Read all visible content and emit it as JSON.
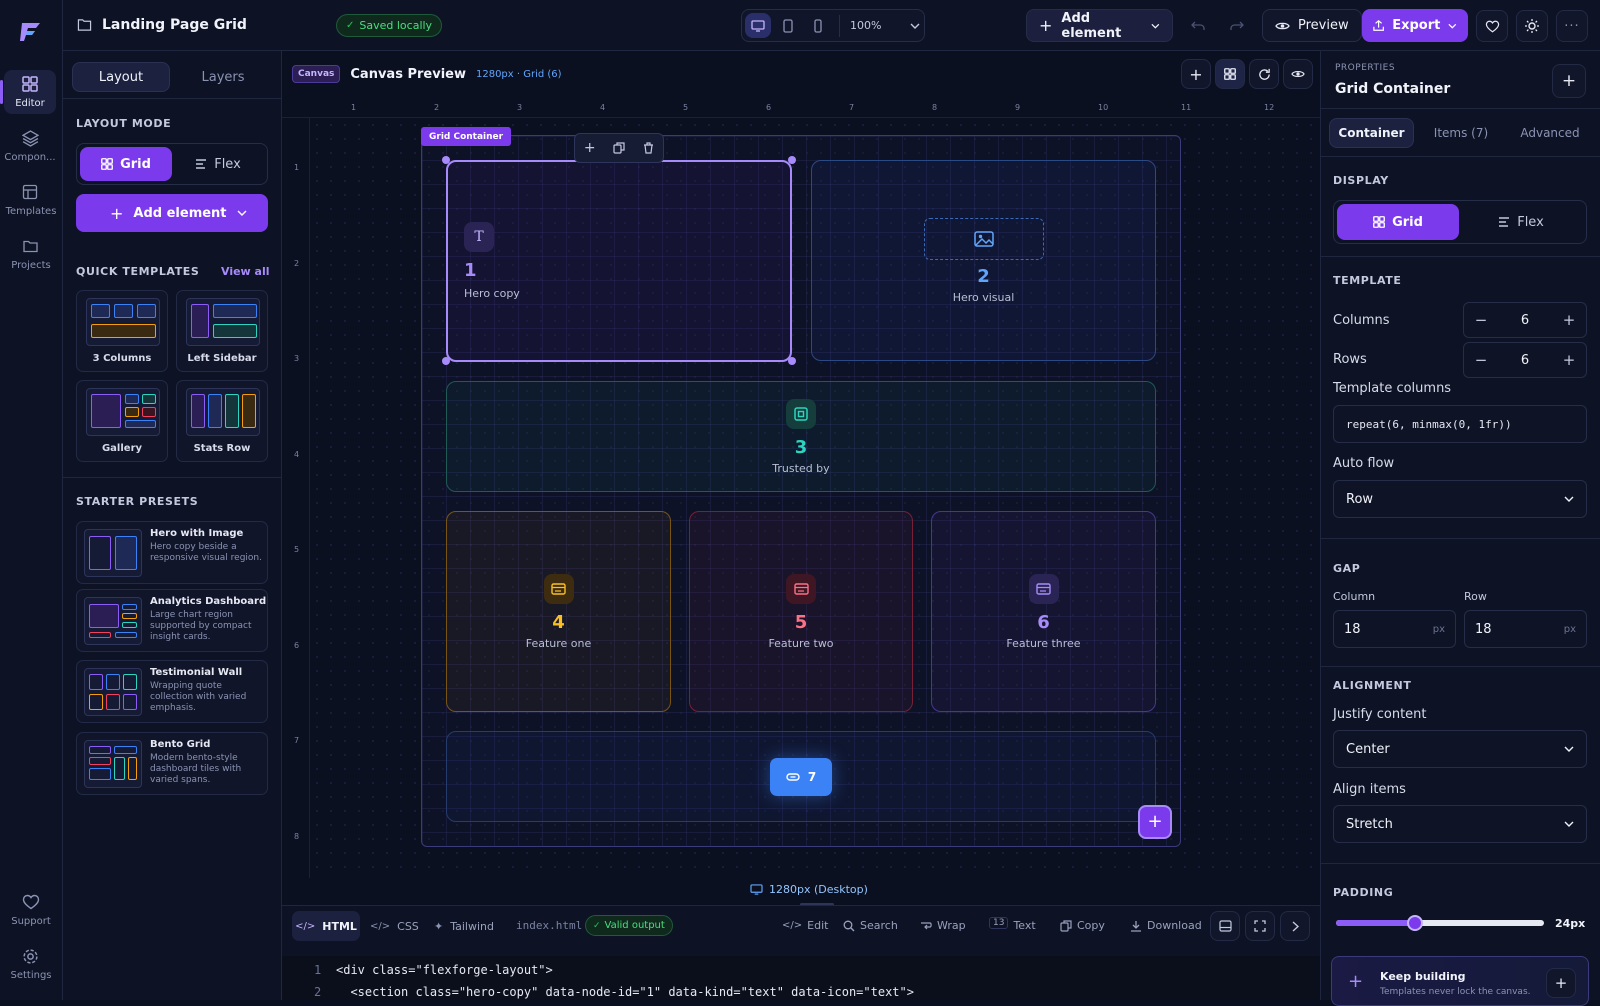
{
  "app": {
    "logo": "F"
  },
  "topbar": {
    "project_title": "Landing Page Grid",
    "save_status": "Saved locally",
    "zoom": "100%",
    "add_element": "Add element",
    "preview": "Preview",
    "export": "Export"
  },
  "sidenav": {
    "items": [
      {
        "label": "Editor"
      },
      {
        "label": "Compon..."
      },
      {
        "label": "Templates"
      },
      {
        "label": "Projects"
      }
    ],
    "support": "Support",
    "settings": "Settings"
  },
  "leftpanel": {
    "tabs": [
      "Layout",
      "Layers"
    ],
    "layout_mode_title": "LAYOUT MODE",
    "mode_grid": "Grid",
    "mode_flex": "Flex",
    "add_element": "Add element",
    "quick_templates_title": "QUICK TEMPLATES",
    "view_all": "View all",
    "quick_templates": [
      "3 Columns",
      "Left Sidebar",
      "Gallery",
      "Stats Row"
    ],
    "starter_presets_title": "STARTER PRESETS",
    "presets": [
      {
        "title": "Hero with Image",
        "desc": "Hero copy beside a responsive visual region."
      },
      {
        "title": "Analytics Dashboard",
        "desc": "Large chart region supported by compact insight cards."
      },
      {
        "title": "Testimonial Wall",
        "desc": "Wrapping quote collection with varied emphasis."
      },
      {
        "title": "Bento Grid",
        "desc": "Modern bento-style dashboard tiles with varied spans."
      }
    ]
  },
  "canvas": {
    "badge": "Canvas",
    "title": "Canvas Preview",
    "meta": "1280px · Grid (6)",
    "container_label": "Grid Container",
    "col_ruler": [
      "1",
      "2",
      "3",
      "4",
      "5",
      "6",
      "7",
      "8",
      "9",
      "10",
      "11",
      "12"
    ],
    "row_ruler": [
      "1",
      "2",
      "3",
      "4",
      "5",
      "6",
      "7",
      "8"
    ],
    "tiles": [
      {
        "num": "1",
        "label": "Hero copy"
      },
      {
        "num": "2",
        "label": "Hero visual"
      },
      {
        "num": "3",
        "label": "Trusted by"
      },
      {
        "num": "4",
        "label": "Feature one"
      },
      {
        "num": "5",
        "label": "Feature two"
      },
      {
        "num": "6",
        "label": "Feature three"
      },
      {
        "num": "7",
        "label": ""
      }
    ],
    "viewport": "1280px (Desktop)"
  },
  "codepanel": {
    "tabs": [
      "HTML",
      "CSS",
      "Tailwind"
    ],
    "filename": "index.html",
    "valid": "Valid output",
    "tools": [
      "Edit",
      "Search",
      "Wrap",
      "Text",
      "Copy",
      "Download"
    ],
    "text_size": "13",
    "lines": [
      {
        "n": "1",
        "code": "<div class=\"flexforge-layout\">"
      },
      {
        "n": "2",
        "code": "  <section class=\"hero-copy\" data-node-id=\"1\" data-kind=\"text\" data-icon=\"text\">"
      }
    ]
  },
  "properties": {
    "eyebrow": "PROPERTIES",
    "title": "Grid Container",
    "tabs": [
      "Container",
      "Items (7)",
      "Advanced"
    ],
    "display_title": "DISPLAY",
    "display_grid": "Grid",
    "display_flex": "Flex",
    "template_title": "TEMPLATE",
    "columns_label": "Columns",
    "columns_value": "6",
    "rows_label": "Rows",
    "rows_value": "6",
    "template_columns_label": "Template columns",
    "template_columns_value": "repeat(6, minmax(0, 1fr))",
    "auto_flow_label": "Auto flow",
    "auto_flow_value": "Row",
    "gap_title": "GAP",
    "gap_column_label": "Column",
    "gap_column_value": "18",
    "gap_row_label": "Row",
    "gap_row_value": "18",
    "gap_unit": "px",
    "alignment_title": "ALIGNMENT",
    "justify_label": "Justify content",
    "justify_value": "Center",
    "align_label": "Align items",
    "align_value": "Stretch",
    "padding_title": "PADDING",
    "padding_value": "24px",
    "padding_fraction": 0.38,
    "keep_title": "Keep building",
    "keep_desc": "Templates never lock the canvas."
  },
  "colors": {
    "accent": "#7c3aed",
    "accent_light": "#a78bfa",
    "tile_blue": "#3b82f6",
    "tile_teal": "#2dd4bf",
    "tile_amber": "#f59e0b",
    "tile_red": "#f43f5e",
    "tile_violet": "#8b5cf6",
    "success": "#22c55e"
  }
}
